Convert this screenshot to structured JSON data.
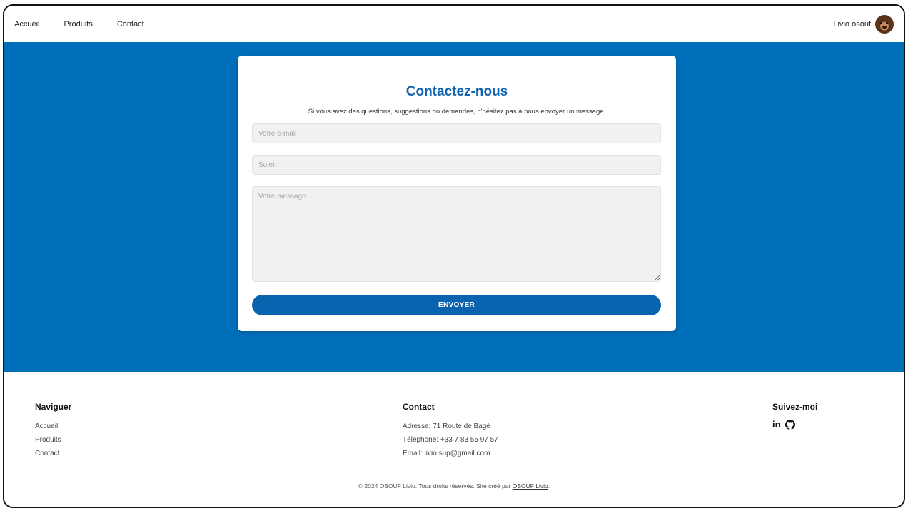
{
  "nav": {
    "links": [
      "Accueil",
      "Produits",
      "Contact"
    ],
    "user_name": "Livio osouf"
  },
  "form": {
    "title": "Contactez-nous",
    "subtitle": "Si vous avez des questions, suggestions ou demandes, n'hésitez pas à nous envoyer un message.",
    "email_placeholder": "Votre e-mail",
    "subject_placeholder": "Sujet",
    "message_placeholder": "Votre message",
    "submit_label": "ENVOYER"
  },
  "footer": {
    "nav_title": "Naviguer",
    "nav_links": [
      "Accueil",
      "Produits",
      "Contact"
    ],
    "contact_title": "Contact",
    "address": "Adresse: 71 Route de Bagé",
    "phone": "Téléphone: +33 7 83 55 97 57",
    "email": "Email: livio.sup@gmail.com",
    "social_title": "Suivez-moi",
    "social_icons": [
      "linkedin-icon",
      "github-icon"
    ],
    "copyright_prefix": "© 2024 OSOUF Livio. Tous droits réservés. Site créé par ",
    "copyright_link": "OSOUF Livio",
    "copyright_suffix": "."
  },
  "colors": {
    "primary": "#006fba",
    "title": "#1265b0",
    "button": "#0a63ae"
  }
}
